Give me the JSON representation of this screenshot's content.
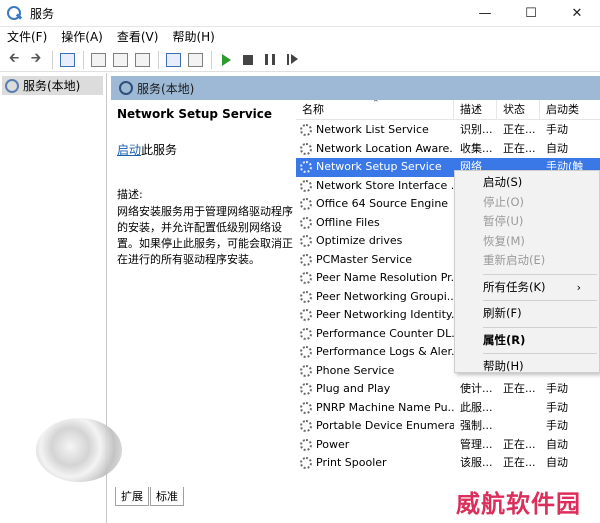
{
  "window": {
    "title": "服务",
    "minimize": "—",
    "maximize": "☐",
    "close": "✕"
  },
  "menu": [
    "文件(F)",
    "操作(A)",
    "查看(V)",
    "帮助(H)"
  ],
  "tree": {
    "label": "服务(本地)"
  },
  "header": {
    "label": "服务(本地)"
  },
  "details": {
    "service_name": "Network Setup Service",
    "start_link": "启动",
    "start_suffix": "此服务",
    "desc_label": "描述:",
    "description": "网络安装服务用于管理网络驱动程序的安装，并允许配置低级别网络设置。如果停止此服务，可能会取消正在进行的所有驱动程序安装。"
  },
  "columns": {
    "name": "名称",
    "desc": "描述",
    "status": "状态",
    "startup": "启动类"
  },
  "rows": [
    {
      "name": "Network List Service",
      "desc": "识别...",
      "status": "正在...",
      "startup": "手动"
    },
    {
      "name": "Network Location Aware...",
      "desc": "收集...",
      "status": "正在...",
      "startup": "自动"
    },
    {
      "name": "Network Setup Service",
      "desc": "网络",
      "status": "",
      "startup": "手动(触"
    },
    {
      "name": "Network Store Interface ...",
      "desc": "",
      "status": "",
      "startup": ""
    },
    {
      "name": "Office 64 Source Engine",
      "desc": "",
      "status": "",
      "startup": ""
    },
    {
      "name": "Offline Files",
      "desc": "",
      "status": "",
      "startup": ""
    },
    {
      "name": "Optimize drives",
      "desc": "",
      "status": "",
      "startup": ""
    },
    {
      "name": "PCMaster Service",
      "desc": "",
      "status": "",
      "startup": ""
    },
    {
      "name": "Peer Name Resolution Pr...",
      "desc": "",
      "status": "",
      "startup": ""
    },
    {
      "name": "Peer Networking Groupi...",
      "desc": "",
      "status": "",
      "startup": ""
    },
    {
      "name": "Peer Networking Identity...",
      "desc": "",
      "status": "",
      "startup": ""
    },
    {
      "name": "Performance Counter DL...",
      "desc": "",
      "status": "",
      "startup": ""
    },
    {
      "name": "Performance Logs & Aler...",
      "desc": "",
      "status": "",
      "startup": ""
    },
    {
      "name": "Phone Service",
      "desc": "",
      "status": "",
      "startup": ""
    },
    {
      "name": "Plug and Play",
      "desc": "使计...",
      "status": "正在...",
      "startup": "手动"
    },
    {
      "name": "PNRP Machine Name Pu...",
      "desc": "此服...",
      "status": "",
      "startup": "手动"
    },
    {
      "name": "Portable Device Enumera...",
      "desc": "强制...",
      "status": "",
      "startup": "手动"
    },
    {
      "name": "Power",
      "desc": "管理...",
      "status": "正在...",
      "startup": "自动"
    },
    {
      "name": "Print Spooler",
      "desc": "该服...",
      "status": "正在...",
      "startup": "自动"
    }
  ],
  "context_menu": [
    {
      "label": "启动(S)",
      "state": "enabled"
    },
    {
      "label": "停止(O)",
      "state": "disabled"
    },
    {
      "label": "暂停(U)",
      "state": "disabled"
    },
    {
      "label": "恢复(M)",
      "state": "disabled"
    },
    {
      "label": "重新启动(E)",
      "state": "disabled"
    },
    {
      "label": "所有任务(K)",
      "state": "submenu"
    },
    {
      "label": "刷新(F)",
      "state": "enabled"
    },
    {
      "label": "属性(R)",
      "state": "bold"
    },
    {
      "label": "帮助(H)",
      "state": "enabled"
    }
  ],
  "tabs": [
    "扩展",
    "标准"
  ],
  "watermark": "威航软件园",
  "colors": {
    "selection": "#3b78e7",
    "header_strip": "#9eb9d6",
    "link": "#1a5fb4"
  }
}
